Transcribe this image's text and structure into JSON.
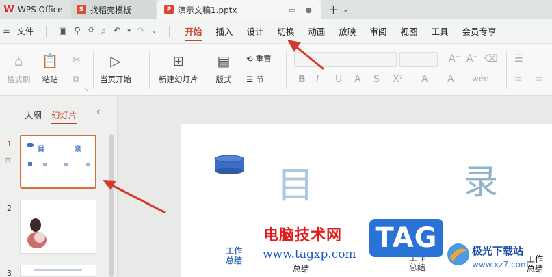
{
  "tabs": {
    "wps": "WPS Office",
    "template": "找稻壳模板",
    "document": "演示文稿1.pptx",
    "new_tab_icon": "plus-icon"
  },
  "menubar": {
    "file": "文件",
    "items": [
      "开始",
      "插入",
      "设计",
      "切换",
      "动画",
      "放映",
      "审阅",
      "视图",
      "工具",
      "会员专享"
    ],
    "active_index": 0
  },
  "ribbon": {
    "format_painter": "格式刷",
    "paste": "粘贴",
    "from_current": "当页开始",
    "new_slide": "新建幻灯片",
    "layout": "版式",
    "reset": "重置",
    "section": "节"
  },
  "left_panel": {
    "tab_outline": "大纲",
    "tab_slides": "幻灯片",
    "slide_numbers": [
      "1",
      "2",
      "3"
    ]
  },
  "slide": {
    "title_left": "目",
    "title_right": "录",
    "item1_line1": "工作",
    "item1_line2": "总结",
    "item2": "总结",
    "item3_line1": "工作",
    "item3_line2": "总结",
    "item4_line1": "工作",
    "item4_line2": "总结"
  },
  "watermark": {
    "site_cn": "电脑技术网",
    "site_url": "www.tagxp.com",
    "tag": "TAG",
    "xz_cn": "极光下载站",
    "xz_url": "www.xz7.com"
  },
  "thumb1": {
    "t1": "目",
    "t2": "录"
  },
  "colors": {
    "accent": "#c7432f",
    "selection": "#d0703d",
    "arrow": "#d33a2c"
  }
}
